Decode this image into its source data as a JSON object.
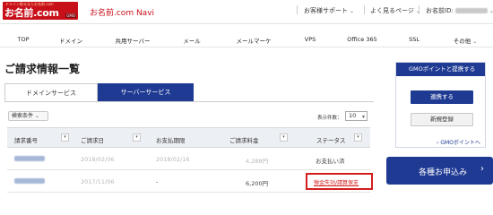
{
  "header": {
    "logo_tagline": "ドメイン取るならお名前.com",
    "logo_text": "お名前.com",
    "logo_badge": "GMO",
    "brand": "お名前.com Navi",
    "support_label": "お客様サポート",
    "faq_label": "よく見るページ",
    "customer_id_label": "お名前ID"
  },
  "nav": {
    "items": [
      "TOP",
      "ドメイン",
      "共用サーバー",
      "メール",
      "メールマーケ",
      "VPS",
      "Office 365",
      "SSL",
      "その他"
    ]
  },
  "main": {
    "title": "ご請求情報一覧",
    "tabs": [
      "ドメインサービス",
      "サーバーサービス"
    ],
    "filter_label": "検索条件",
    "per_page_label": "表示件数：",
    "per_page_value": "10",
    "columns": [
      "請求番号",
      "ご請求日",
      "お支払期限",
      "ご請求料金",
      "ステータス"
    ],
    "rows": [
      {
        "id": "",
        "date": "2018/02/06",
        "due": "2018/02/16",
        "amount": "4,288円",
        "status": "お支払い済"
      },
      {
        "id": "",
        "date": "2017/11/06",
        "due": "-",
        "amount": "6,200円",
        "status": "弾金失効/請算保支"
      }
    ]
  },
  "sidebar": {
    "gmo_heading": "GMOポイントと提携する",
    "link_button": "連携する",
    "register_button": "新規登録",
    "more_link": "GMOポイントへ",
    "apply_button": "各種お申込み"
  },
  "colors": {
    "brand_red": "#c8101a",
    "navy": "#1f3a93",
    "alert_red": "#d41e1e"
  }
}
